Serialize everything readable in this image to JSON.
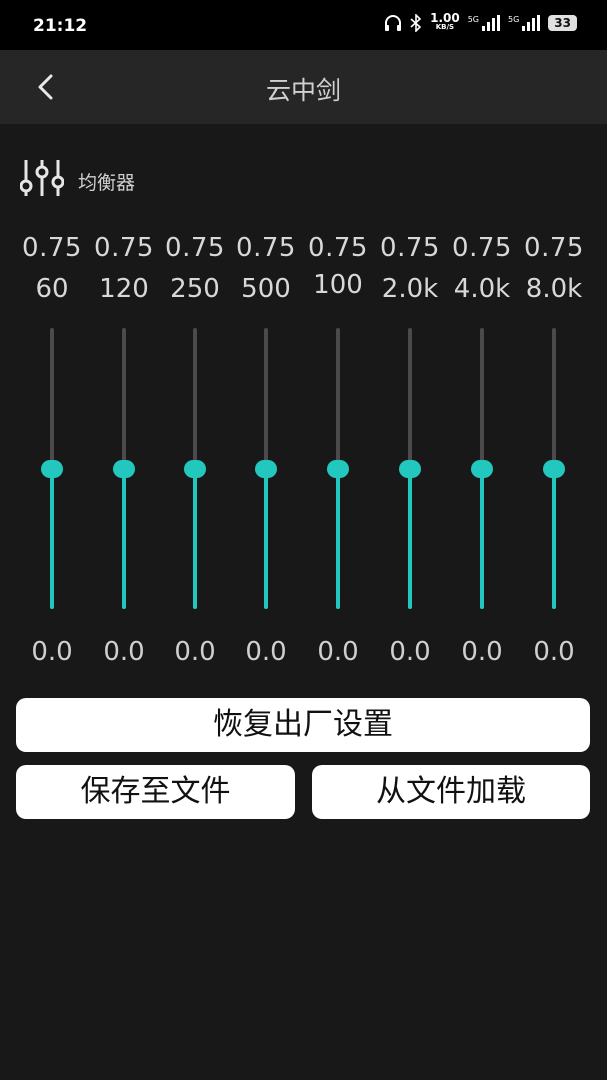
{
  "status_bar": {
    "time": "21:12",
    "net_speed_value": "1.00",
    "net_speed_unit": "KB/S",
    "sim1_label": "5G",
    "sim2_label": "5G",
    "battery": "33"
  },
  "header": {
    "title": "云中剑"
  },
  "equalizer": {
    "label": "均衡器",
    "accent_color": "#22c8bd",
    "bands": [
      {
        "value": "0.75",
        "freq": "60",
        "gain": "0.0",
        "level": 0.5
      },
      {
        "value": "0.75",
        "freq": "120",
        "gain": "0.0",
        "level": 0.5
      },
      {
        "value": "0.75",
        "freq": "250",
        "gain": "0.0",
        "level": 0.5
      },
      {
        "value": "0.75",
        "freq": "500",
        "gain": "0.0",
        "level": 0.5
      },
      {
        "value": "0.75",
        "freq": "100",
        "gain": "0.0",
        "level": 0.5
      },
      {
        "value": "0.75",
        "freq": "2.0k",
        "gain": "0.0",
        "level": 0.5
      },
      {
        "value": "0.75",
        "freq": "4.0k",
        "gain": "0.0",
        "level": 0.5
      },
      {
        "value": "0.75",
        "freq": "8.0k",
        "gain": "0.0",
        "level": 0.5
      }
    ]
  },
  "buttons": {
    "reset": "恢复出厂设置",
    "save": "保存至文件",
    "load": "从文件加载"
  }
}
